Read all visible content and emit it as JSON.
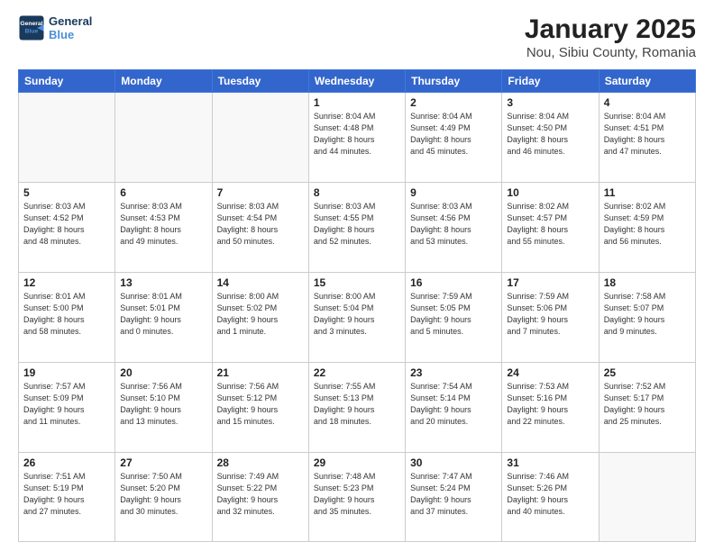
{
  "logo": {
    "line1": "General",
    "line2": "Blue"
  },
  "title": "January 2025",
  "subtitle": "Nou, Sibiu County, Romania",
  "days_header": [
    "Sunday",
    "Monday",
    "Tuesday",
    "Wednesday",
    "Thursday",
    "Friday",
    "Saturday"
  ],
  "weeks": [
    [
      {
        "num": "",
        "info": ""
      },
      {
        "num": "",
        "info": ""
      },
      {
        "num": "",
        "info": ""
      },
      {
        "num": "1",
        "info": "Sunrise: 8:04 AM\nSunset: 4:48 PM\nDaylight: 8 hours\nand 44 minutes."
      },
      {
        "num": "2",
        "info": "Sunrise: 8:04 AM\nSunset: 4:49 PM\nDaylight: 8 hours\nand 45 minutes."
      },
      {
        "num": "3",
        "info": "Sunrise: 8:04 AM\nSunset: 4:50 PM\nDaylight: 8 hours\nand 46 minutes."
      },
      {
        "num": "4",
        "info": "Sunrise: 8:04 AM\nSunset: 4:51 PM\nDaylight: 8 hours\nand 47 minutes."
      }
    ],
    [
      {
        "num": "5",
        "info": "Sunrise: 8:03 AM\nSunset: 4:52 PM\nDaylight: 8 hours\nand 48 minutes."
      },
      {
        "num": "6",
        "info": "Sunrise: 8:03 AM\nSunset: 4:53 PM\nDaylight: 8 hours\nand 49 minutes."
      },
      {
        "num": "7",
        "info": "Sunrise: 8:03 AM\nSunset: 4:54 PM\nDaylight: 8 hours\nand 50 minutes."
      },
      {
        "num": "8",
        "info": "Sunrise: 8:03 AM\nSunset: 4:55 PM\nDaylight: 8 hours\nand 52 minutes."
      },
      {
        "num": "9",
        "info": "Sunrise: 8:03 AM\nSunset: 4:56 PM\nDaylight: 8 hours\nand 53 minutes."
      },
      {
        "num": "10",
        "info": "Sunrise: 8:02 AM\nSunset: 4:57 PM\nDaylight: 8 hours\nand 55 minutes."
      },
      {
        "num": "11",
        "info": "Sunrise: 8:02 AM\nSunset: 4:59 PM\nDaylight: 8 hours\nand 56 minutes."
      }
    ],
    [
      {
        "num": "12",
        "info": "Sunrise: 8:01 AM\nSunset: 5:00 PM\nDaylight: 8 hours\nand 58 minutes."
      },
      {
        "num": "13",
        "info": "Sunrise: 8:01 AM\nSunset: 5:01 PM\nDaylight: 9 hours\nand 0 minutes."
      },
      {
        "num": "14",
        "info": "Sunrise: 8:00 AM\nSunset: 5:02 PM\nDaylight: 9 hours\nand 1 minute."
      },
      {
        "num": "15",
        "info": "Sunrise: 8:00 AM\nSunset: 5:04 PM\nDaylight: 9 hours\nand 3 minutes."
      },
      {
        "num": "16",
        "info": "Sunrise: 7:59 AM\nSunset: 5:05 PM\nDaylight: 9 hours\nand 5 minutes."
      },
      {
        "num": "17",
        "info": "Sunrise: 7:59 AM\nSunset: 5:06 PM\nDaylight: 9 hours\nand 7 minutes."
      },
      {
        "num": "18",
        "info": "Sunrise: 7:58 AM\nSunset: 5:07 PM\nDaylight: 9 hours\nand 9 minutes."
      }
    ],
    [
      {
        "num": "19",
        "info": "Sunrise: 7:57 AM\nSunset: 5:09 PM\nDaylight: 9 hours\nand 11 minutes."
      },
      {
        "num": "20",
        "info": "Sunrise: 7:56 AM\nSunset: 5:10 PM\nDaylight: 9 hours\nand 13 minutes."
      },
      {
        "num": "21",
        "info": "Sunrise: 7:56 AM\nSunset: 5:12 PM\nDaylight: 9 hours\nand 15 minutes."
      },
      {
        "num": "22",
        "info": "Sunrise: 7:55 AM\nSunset: 5:13 PM\nDaylight: 9 hours\nand 18 minutes."
      },
      {
        "num": "23",
        "info": "Sunrise: 7:54 AM\nSunset: 5:14 PM\nDaylight: 9 hours\nand 20 minutes."
      },
      {
        "num": "24",
        "info": "Sunrise: 7:53 AM\nSunset: 5:16 PM\nDaylight: 9 hours\nand 22 minutes."
      },
      {
        "num": "25",
        "info": "Sunrise: 7:52 AM\nSunset: 5:17 PM\nDaylight: 9 hours\nand 25 minutes."
      }
    ],
    [
      {
        "num": "26",
        "info": "Sunrise: 7:51 AM\nSunset: 5:19 PM\nDaylight: 9 hours\nand 27 minutes."
      },
      {
        "num": "27",
        "info": "Sunrise: 7:50 AM\nSunset: 5:20 PM\nDaylight: 9 hours\nand 30 minutes."
      },
      {
        "num": "28",
        "info": "Sunrise: 7:49 AM\nSunset: 5:22 PM\nDaylight: 9 hours\nand 32 minutes."
      },
      {
        "num": "29",
        "info": "Sunrise: 7:48 AM\nSunset: 5:23 PM\nDaylight: 9 hours\nand 35 minutes."
      },
      {
        "num": "30",
        "info": "Sunrise: 7:47 AM\nSunset: 5:24 PM\nDaylight: 9 hours\nand 37 minutes."
      },
      {
        "num": "31",
        "info": "Sunrise: 7:46 AM\nSunset: 5:26 PM\nDaylight: 9 hours\nand 40 minutes."
      },
      {
        "num": "",
        "info": ""
      }
    ]
  ]
}
